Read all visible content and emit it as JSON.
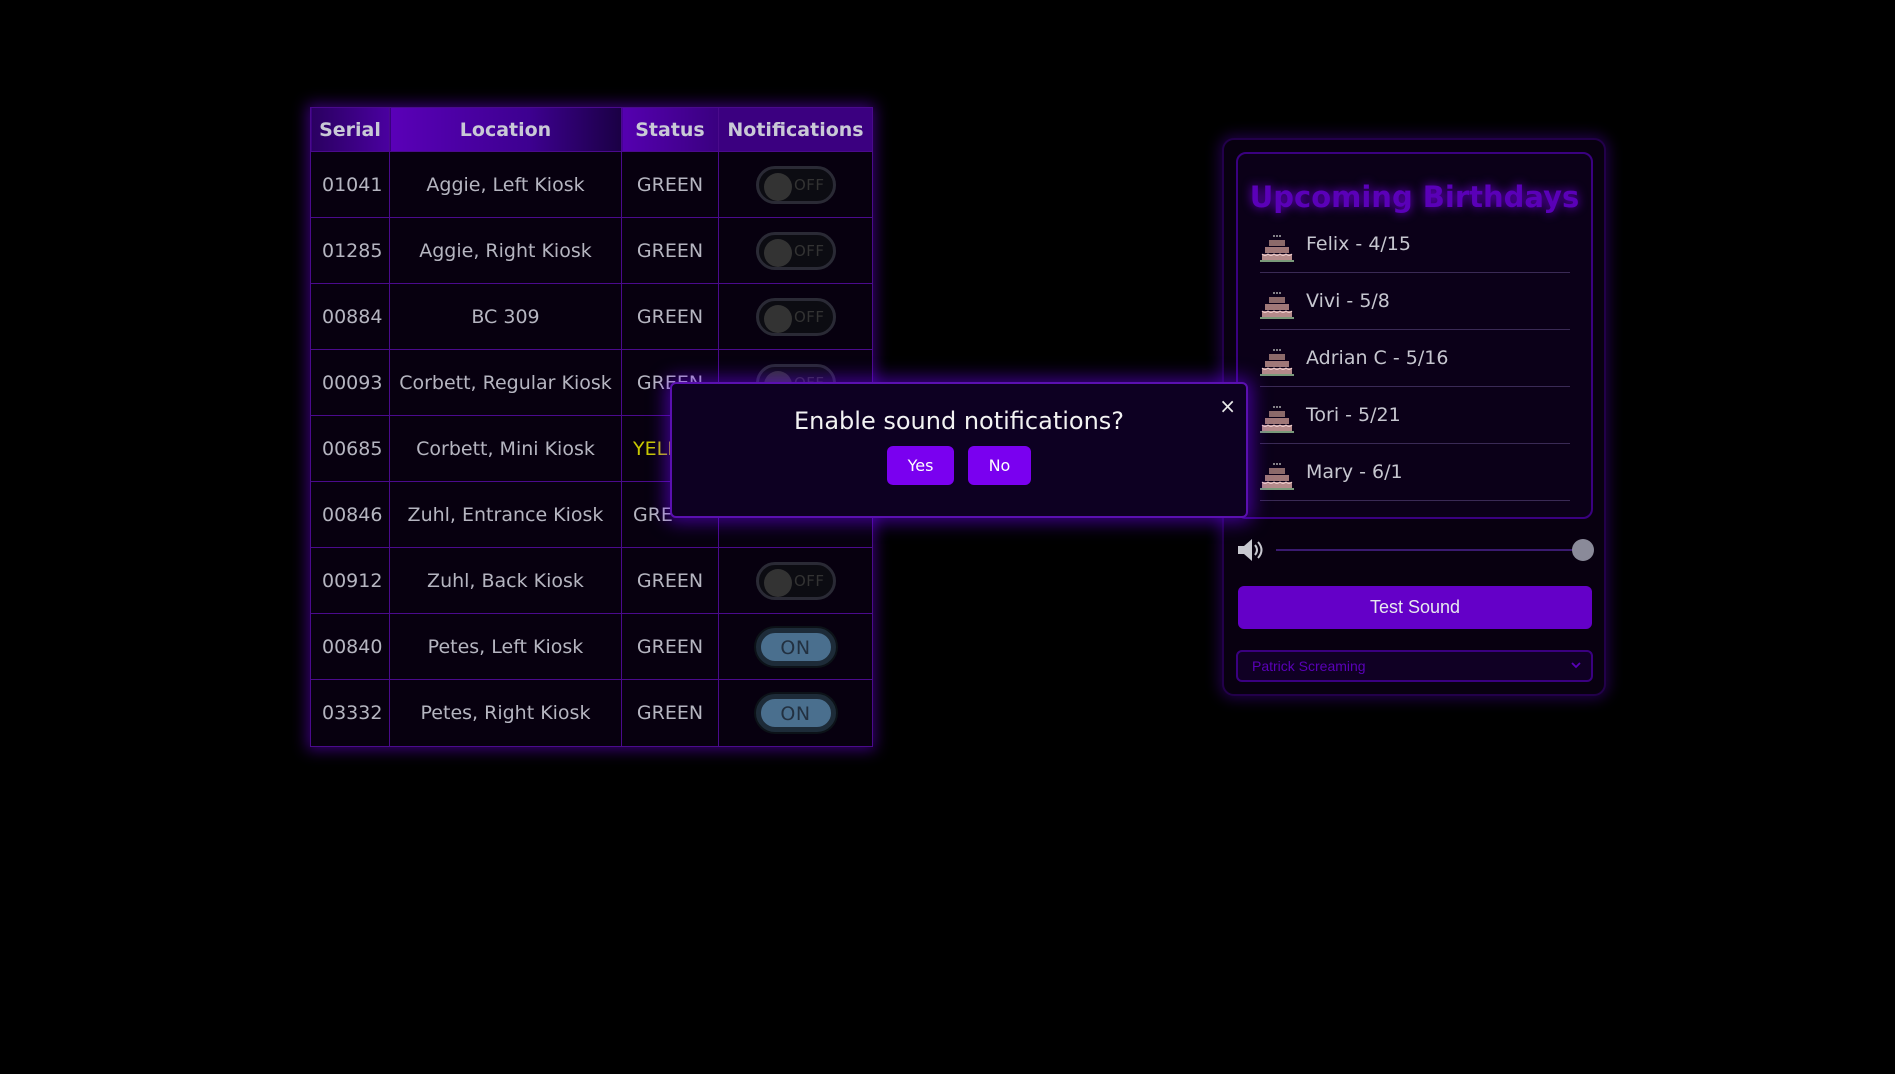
{
  "table": {
    "headers": {
      "serial": "Serial",
      "location": "Location",
      "status": "Status",
      "notifications": "Notifications"
    },
    "rows": [
      {
        "serial": "01041",
        "location": "Aggie, Left Kiosk",
        "status": "GREEN",
        "notification": "OFF"
      },
      {
        "serial": "01285",
        "location": "Aggie, Right Kiosk",
        "status": "GREEN",
        "notification": "OFF"
      },
      {
        "serial": "00884",
        "location": "BC 309",
        "status": "GREEN",
        "notification": "OFF"
      },
      {
        "serial": "00093",
        "location": "Corbett, Regular Kiosk",
        "status": "GREEN",
        "notification": "OFF"
      },
      {
        "serial": "00685",
        "location": "Corbett, Mini Kiosk",
        "status": "YELL",
        "notification": ""
      },
      {
        "serial": "00846",
        "location": "Zuhl, Entrance Kiosk",
        "status": "GRE",
        "notification": ""
      },
      {
        "serial": "00912",
        "location": "Zuhl, Back Kiosk",
        "status": "GREEN",
        "notification": "OFF"
      },
      {
        "serial": "00840",
        "location": "Petes, Left Kiosk",
        "status": "GREEN",
        "notification": "ON"
      },
      {
        "serial": "03332",
        "location": "Petes, Right Kiosk",
        "status": "GREEN",
        "notification": "ON"
      }
    ]
  },
  "modal": {
    "title": "Enable sound notifications?",
    "close": "×",
    "yes_label": "Yes",
    "no_label": "No"
  },
  "birthdays": {
    "title": "Upcoming Birthdays",
    "items": [
      {
        "text": "Felix - 4/15"
      },
      {
        "text": "Vivi - 5/8"
      },
      {
        "text": "Adrian C - 5/16"
      },
      {
        "text": "Tori - 5/21"
      },
      {
        "text": "Mary - 6/1"
      }
    ],
    "icon": "birthday-cake-icon"
  },
  "sound": {
    "volume": 1.0,
    "test_label": "Test Sound",
    "selected_sound": "Patrick Screaming"
  },
  "colors": {
    "accent": "#7a00f0",
    "status_green": "#b5b5c0",
    "status_yellow": "#c8c800",
    "toggle_on": "#4a6f8e"
  }
}
